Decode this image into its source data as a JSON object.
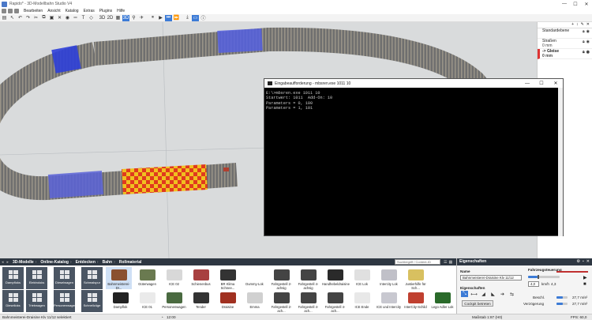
{
  "window": {
    "title": "Rapido* - 3D-Modellbahn Studio V4",
    "minimize": "—",
    "maximize": "☐",
    "close": "✕"
  },
  "menu": {
    "items": [
      "Bearbeiten",
      "Ansicht",
      "Katalog",
      "Extras",
      "Plugins",
      "Hilfe"
    ]
  },
  "toolbar": {
    "mode_3d": "3D",
    "mode_2d": "2D",
    "mode_grid": "▦",
    "mode_3d_alt": "3D",
    "pause": "⏸",
    "play": "▶",
    "step": "⏭",
    "fast": "⏩"
  },
  "layers": {
    "tools": [
      "+",
      "↕",
      "✎",
      "✕"
    ],
    "items": [
      {
        "name": "Standardebene",
        "sub": "",
        "selected": false
      },
      {
        "name": "Straßen",
        "sub": "0 mm",
        "selected": false
      },
      {
        "name": "-> Gleise",
        "sub": "0 mm",
        "selected": true
      }
    ]
  },
  "console": {
    "title": "Eingabeaufforderung - mbsren.exe  1011 10",
    "lines": [
      "E:\\>mbsren.exe 1011 10",
      "Startwert: 1011  Add-On: 10",
      "Parameters = 0, 100",
      "Parameters = 1, 101"
    ]
  },
  "catalog": {
    "breadcrumb": [
      "3D-Modelle",
      "Online-Katalog",
      "Entdecken",
      "Bahn",
      "Rollmaterial"
    ],
    "search_placeholder": "Suchbegriff / Content-ID",
    "tiles_top": [
      "Dampfloks",
      "Elektroloks",
      "Dieselwagen",
      "Schmalspur"
    ],
    "tiles_bottom": [
      "Diesel­loks",
      "Triebwagen",
      "Personenwagen",
      "Schnellzüge"
    ],
    "items_top": [
      "Bahnmeisterei-Dr...",
      "Güterwagen",
      "ICE 02",
      "Schienenbus",
      "BR Klima Schnee...",
      "Dummy-Lok",
      "Fahrgestell 2-achsig",
      "Fahrgestell 4-achsig",
      "Handhebeldraisine",
      "ICE Lok",
      "Intercity Lok",
      "Justierhilfe für Sch..."
    ],
    "items_bottom": [
      "Dampflok",
      "ICE 01",
      "Personenwagen",
      "Tender",
      "Draisine",
      "Emma",
      "Fahrgestell 2-ach...",
      "Fahrgestell 4-ach...",
      "Fahrgestell 4-ach...",
      "ICE Ende",
      "ICE und Intercity",
      "InterCity-Schild",
      "Lego Adler Lok"
    ]
  },
  "properties": {
    "header": "Eigenschaften",
    "name_label": "Name",
    "name_value": "Bahnmeisterei-Draisine Klv 11/12",
    "drive_label": "Fahrzeugsteuerung",
    "speed_value": "4,0",
    "speed_unit": "km/h",
    "speed_max": "4,3",
    "props_label": "Eigenschaften",
    "cockpit_button": "Cockpit betreten",
    "accel_label": "Beschl.",
    "accel_value": "27,7 m/s²",
    "decel_label": "Verzögerung",
    "decel_value": "27,7 m/s²"
  },
  "status": {
    "selection": "Bahnmeisterei-Draisine Klv 11/12 selektiert",
    "time": "12:00",
    "scale": "Maßstab 1:87 (H0)",
    "fps": "FPS: 60,0"
  },
  "colors": {
    "accent": "#3c7bd6",
    "dark_bar": "#2e3742",
    "selected_layer": "#dd3333"
  }
}
